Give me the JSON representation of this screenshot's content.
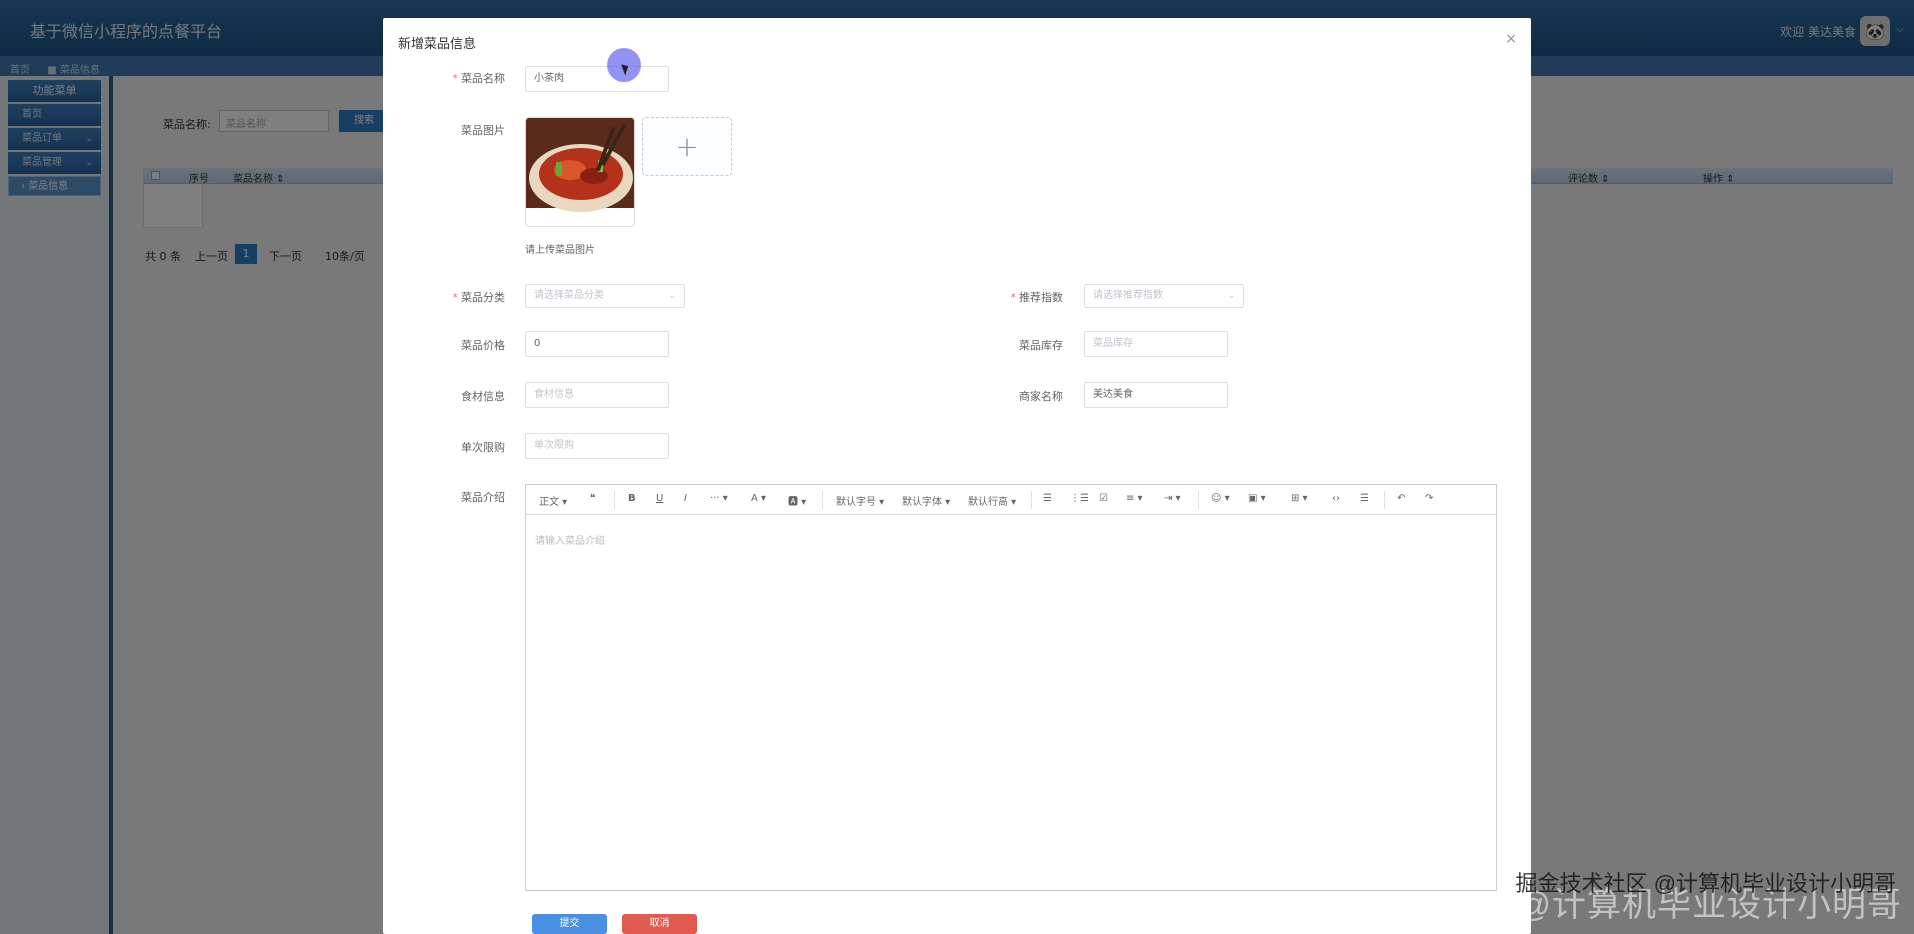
{
  "app": {
    "title": "基于微信小程序的点餐平台",
    "welcome": "欢迎 美达美食",
    "avatar": "🐼"
  },
  "breadcrumb": [
    "首页",
    "■ 菜品信息"
  ],
  "sidebar": {
    "header": "功能菜单",
    "items": [
      {
        "label": "首页"
      },
      {
        "label": "菜品订单"
      },
      {
        "label": "菜品管理"
      }
    ],
    "active_sub": "菜品信息"
  },
  "list": {
    "search_label": "菜品名称:",
    "search_placeholder": "菜品名称",
    "search_button": "搜索",
    "columns": [
      "序号",
      "菜品名称 ⇕",
      "评论数 ⇕",
      "操作 ⇕"
    ],
    "total": "共 0 条",
    "prev": "上一页",
    "page": "1",
    "next": "下一页",
    "page_size": "10条/页"
  },
  "dialog": {
    "title": "新增菜品信息",
    "close": "×",
    "fields": {
      "name": {
        "label": "菜品名称",
        "value": "小茶肉"
      },
      "image": {
        "label": "菜品图片",
        "hint": "请上传菜品图片"
      },
      "category": {
        "label": "菜品分类",
        "placeholder": "请选择菜品分类"
      },
      "recommend": {
        "label": "推荐指数",
        "placeholder": "请选择推荐指数"
      },
      "price": {
        "label": "菜品价格",
        "value": "0"
      },
      "stock": {
        "label": "菜品库存",
        "placeholder": "菜品库存"
      },
      "ingredients": {
        "label": "食材信息",
        "placeholder": "食材信息"
      },
      "merchant": {
        "label": "商家名称",
        "value": "美达美食"
      },
      "limit": {
        "label": "单次限购",
        "placeholder": "单次限购"
      },
      "intro": {
        "label": "菜品介绍",
        "placeholder": "请输入菜品介绍"
      }
    },
    "editor_toolbar": {
      "para": "正文 ▾",
      "quote": "❝",
      "bold": "B",
      "underline": "U",
      "italic": "I",
      "more": "··· ▾",
      "font_color": "A ▾",
      "bg_color": "🅰 ▾",
      "font_size": "默认字号 ▾",
      "font_family": "默认字体 ▾",
      "line_height": "默认行高 ▾",
      "bullet": "☰",
      "numbered": "⋮☰",
      "todo": "☑",
      "align": "≡ ▾",
      "indent": "⇥ ▾",
      "emoji": "☺ ▾",
      "image": "▣ ▾",
      "table": "⊞ ▾",
      "code": "‹›",
      "divider": "☰",
      "undo": "↶",
      "redo": "↷"
    },
    "submit": "提交",
    "cancel": "取消"
  },
  "watermark": "CSDN @计算机毕业设计小明哥",
  "watermark2": "掘金技术社区 @计算机毕业设计小明哥",
  "colors": {
    "primary": "#2f7cc8",
    "header": "#1f5486",
    "danger": "#e05a4f",
    "submit": "#4a90e2"
  }
}
